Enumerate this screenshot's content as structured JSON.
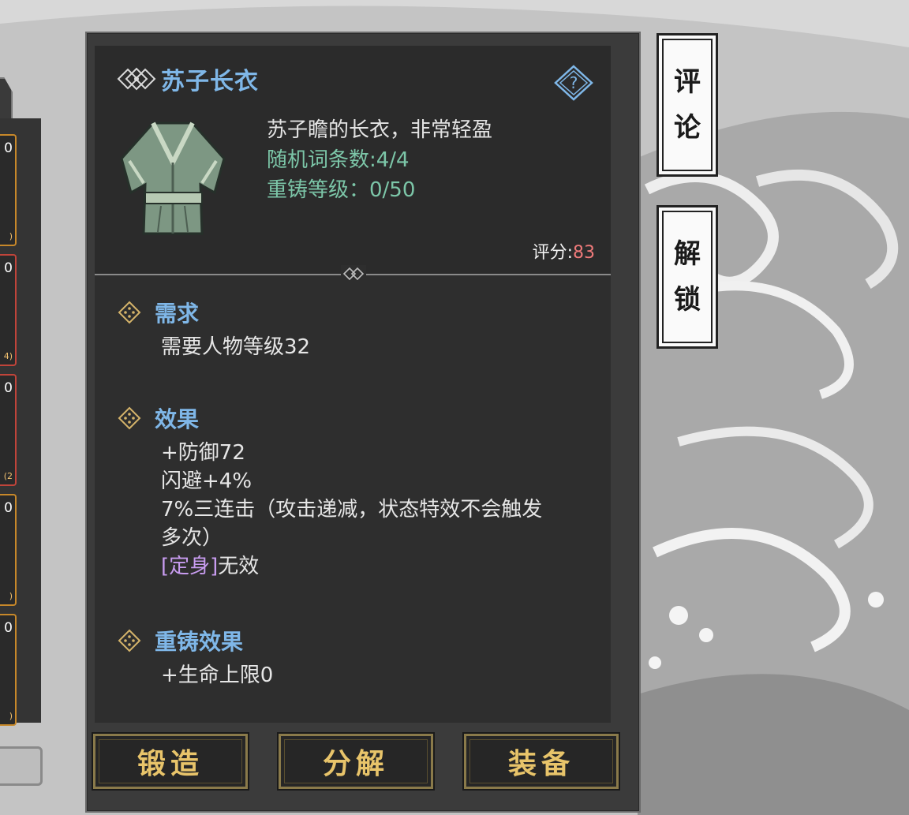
{
  "item": {
    "name": "苏子长衣",
    "description": "苏子瞻的长衣，非常轻盈",
    "random_affixes": "随机词条数:4/4",
    "reforge_level": "重铸等级：0/50",
    "score_label": "评分:",
    "score_value": "83"
  },
  "sections": {
    "requirement": {
      "title": "需求",
      "lines": [
        "需要人物等级32"
      ]
    },
    "effects": {
      "title": "效果",
      "line1": "+防御72",
      "line2": "闪避+4%",
      "line3": "7%三连击（攻击递减，状态特效不会触发",
      "line4": "多次）",
      "line5_tag": "[定身]",
      "line5_text": "无效"
    },
    "reforge_effects": {
      "title": "重铸效果",
      "lines": [
        "+生命上限0"
      ]
    }
  },
  "buttons": {
    "forge": "锻造",
    "dismantle": "分解",
    "equip": "装备"
  },
  "side_tabs": {
    "comment": [
      "评",
      "论"
    ],
    "unlock": [
      "解",
      "锁"
    ]
  },
  "left_list": {
    "slot_numbers": [
      "0",
      "0",
      "0",
      "0",
      "0"
    ],
    "slot_tails": [
      ")",
      "4)",
      "(2",
      ")",
      ")"
    ]
  },
  "colors": {
    "title_blue": "#7fb7e8",
    "affix_green": "#7cc6a8",
    "score_red": "#ef7a7a",
    "button_gold": "#e8c46a",
    "tag_purple": "#c89cf0"
  }
}
